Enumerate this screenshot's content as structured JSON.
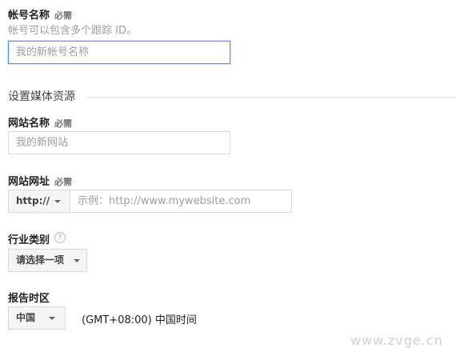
{
  "account": {
    "label": "帐号名称",
    "required": "必需",
    "hint": "帐号可以包含多个跟踪 ID。",
    "placeholder": "我的新帐号名称"
  },
  "property_section": {
    "title": "设置媒体资源"
  },
  "website_name": {
    "label": "网站名称",
    "required": "必需",
    "placeholder": "我的新网站"
  },
  "website_url": {
    "label": "网站网址",
    "required": "必需",
    "protocol": "http://",
    "placeholder": "示例：http://www.mywebsite.com"
  },
  "industry": {
    "label": "行业类别",
    "help_icon": "question-circle-icon",
    "help_glyph": "?",
    "select": "请选择一项"
  },
  "timezone": {
    "label": "报告时区",
    "country": "中国",
    "zone": "(GMT+08:00) 中国时间"
  },
  "watermark": "www.zvge.cn"
}
